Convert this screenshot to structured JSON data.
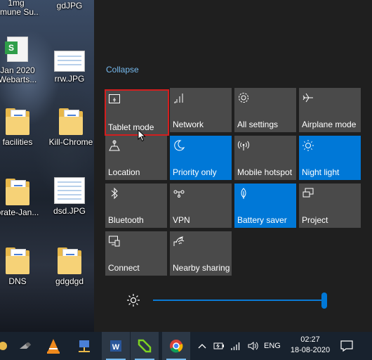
{
  "desktop": {
    "icons": [
      {
        "label": "1mg",
        "label2": "mmune Su..."
      },
      {
        "label": "gdJPG"
      },
      {
        "label": "Jan 2020",
        "label2": "Webarts..."
      },
      {
        "label": "rrw.JPG"
      },
      {
        "label": "facilities"
      },
      {
        "label": "Kill-Chrome"
      },
      {
        "label": "brate-Jan..."
      },
      {
        "label": "dsd.JPG"
      },
      {
        "label": "DNS"
      },
      {
        "label": "gdgdgd"
      }
    ]
  },
  "action_center": {
    "collapse_label": "Collapse",
    "tiles": [
      {
        "label": "Tablet mode",
        "icon": "tablet-mode-icon",
        "on": false
      },
      {
        "label": "Network",
        "icon": "network-icon",
        "on": false
      },
      {
        "label": "All settings",
        "icon": "gear-icon",
        "on": false
      },
      {
        "label": "Airplane mode",
        "icon": "airplane-icon",
        "on": false
      },
      {
        "label": "Location",
        "icon": "location-icon",
        "on": false
      },
      {
        "label": "Priority only",
        "icon": "moon-icon",
        "on": true
      },
      {
        "label": "Mobile hotspot",
        "icon": "hotspot-icon",
        "on": false
      },
      {
        "label": "Night light",
        "icon": "sun-icon",
        "on": true
      },
      {
        "label": "Bluetooth",
        "icon": "bluetooth-icon",
        "on": false
      },
      {
        "label": "VPN",
        "icon": "vpn-icon",
        "on": false
      },
      {
        "label": "Battery saver",
        "icon": "battery-saver-icon",
        "on": true
      },
      {
        "label": "Project",
        "icon": "project-icon",
        "on": false
      },
      {
        "label": "Connect",
        "icon": "connect-icon",
        "on": false
      },
      {
        "label": "Nearby sharing",
        "icon": "nearby-sharing-icon",
        "on": false
      }
    ],
    "brightness_percent": 100
  },
  "taskbar": {
    "language": "ENG",
    "time": "02:27",
    "date": "18-08-2020"
  },
  "colors": {
    "accent": "#0078d7",
    "tile_off": "#4a4a4a",
    "panel": "#1f1f1f",
    "taskbar": "#18222e",
    "focus": "#d31e1e"
  }
}
